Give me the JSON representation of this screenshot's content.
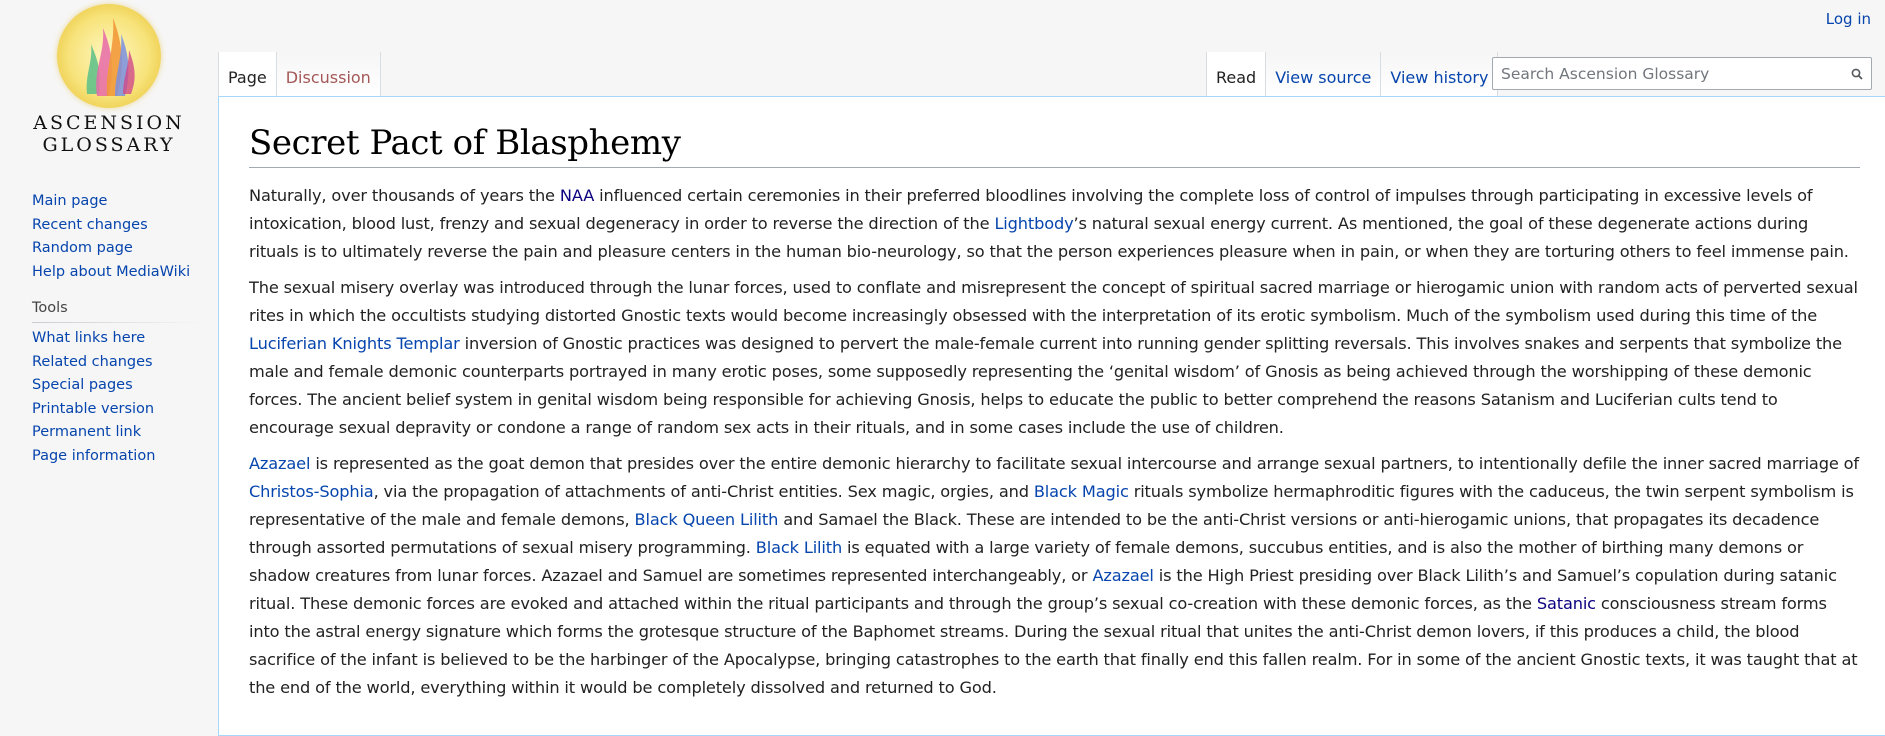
{
  "site": {
    "logo_line1": "ASCENSION",
    "logo_line2": "GLOSSARY"
  },
  "personal": {
    "login": "Log in"
  },
  "tabs": {
    "page": "Page",
    "discussion": "Discussion",
    "read": "Read",
    "view_source": "View source",
    "view_history": "View history"
  },
  "search": {
    "placeholder": "Search Ascension Glossary",
    "icon": "search-icon"
  },
  "sidebar": {
    "nav": [
      {
        "label": "Main page"
      },
      {
        "label": "Recent changes"
      },
      {
        "label": "Random page"
      },
      {
        "label": "Help about MediaWiki"
      }
    ],
    "tools_heading": "Tools",
    "tools": [
      {
        "label": "What links here"
      },
      {
        "label": "Related changes"
      },
      {
        "label": "Special pages"
      },
      {
        "label": "Printable version"
      },
      {
        "label": "Permanent link"
      },
      {
        "label": "Page information"
      }
    ]
  },
  "article": {
    "title": "Secret Pact of Blasphemy",
    "p1": {
      "t1": "Naturally, over thousands of years the ",
      "l1": "NAA",
      "t2": " influenced certain ceremonies in their preferred bloodlines involving the complete loss of control of impulses through participating in excessive levels of intoxication, blood lust, frenzy and sexual degeneracy in order to reverse the direction of the ",
      "l2": "Lightbody",
      "t3": "’s natural sexual energy current. As mentioned, the goal of these degenerate actions during rituals is to ultimately reverse the pain and pleasure centers in the human bio-neurology, so that the person experiences pleasure when in pain, or when they are torturing others to feel immense pain."
    },
    "p2": {
      "t1": "The sexual misery overlay was introduced through the lunar forces, used to conflate and misrepresent the concept of spiritual sacred marriage or hierogamic union with random acts of perverted sexual rites in which the occultists studying distorted Gnostic texts would become increasingly obsessed with the interpretation of its erotic symbolism. Much of the symbolism used during this time of the ",
      "l1": "Luciferian Knights Templar",
      "t2": " inversion of Gnostic practices was designed to pervert the male-female current into running gender splitting reversals. This involves snakes and serpents that symbolize the male and female demonic counterparts portrayed in many erotic poses, some supposedly representing the ‘genital wisdom’ of Gnosis as being achieved through the worshipping of these demonic forces. The ancient belief system in genital wisdom being responsible for achieving Gnosis, helps to educate the public to better comprehend the reasons Satanism and Luciferian cults tend to encourage sexual depravity or condone a range of random sex acts in their rituals, and in some cases include the use of children."
    },
    "p3": {
      "l1": "Azazael",
      "t1": " is represented as the goat demon that presides over the entire demonic hierarchy to facilitate sexual intercourse and arrange sexual partners, to intentionally defile the inner sacred marriage of ",
      "l2": "Christos-Sophia",
      "t2": ", via the propagation of attachments of anti-Christ entities. Sex magic, orgies, and ",
      "l3": "Black Magic",
      "t3": " rituals symbolize hermaphroditic figures with the caduceus, the twin serpent symbolism is representative of the male and female demons, ",
      "l4": "Black Queen Lilith",
      "t4": " and Samael the Black. These are intended to be the anti-Christ versions or anti-hierogamic unions, that propagates its decadence through assorted permutations of sexual misery programming. ",
      "l5": "Black Lilith",
      "t5": " is equated with a large variety of female demons, succubus entities, and is also the mother of birthing many demons or shadow creatures from lunar forces. Azazael and Samuel are sometimes represented interchangeably, or ",
      "l6": "Azazael",
      "t6": " is the High Priest presiding over Black Lilith’s and Samuel’s copulation during satanic ritual. These demonic forces are evoked and attached within the ritual participants and through the group’s sexual co-creation with these demonic forces, as the ",
      "l7": "Satanic",
      "t7": " consciousness stream forms into the astral energy signature which forms the grotesque structure of the Baphomet streams. During the sexual ritual that unites the anti-Christ demon lovers, if this produces a child, the blood sacrifice of the infant is believed to be the harbinger of the Apocalypse, bringing catastrophes to the earth that finally end this fallen realm. For in some of the ancient Gnostic texts, it was taught that at the end of the world, everything within it would be completely dissolved and returned to God."
    }
  }
}
